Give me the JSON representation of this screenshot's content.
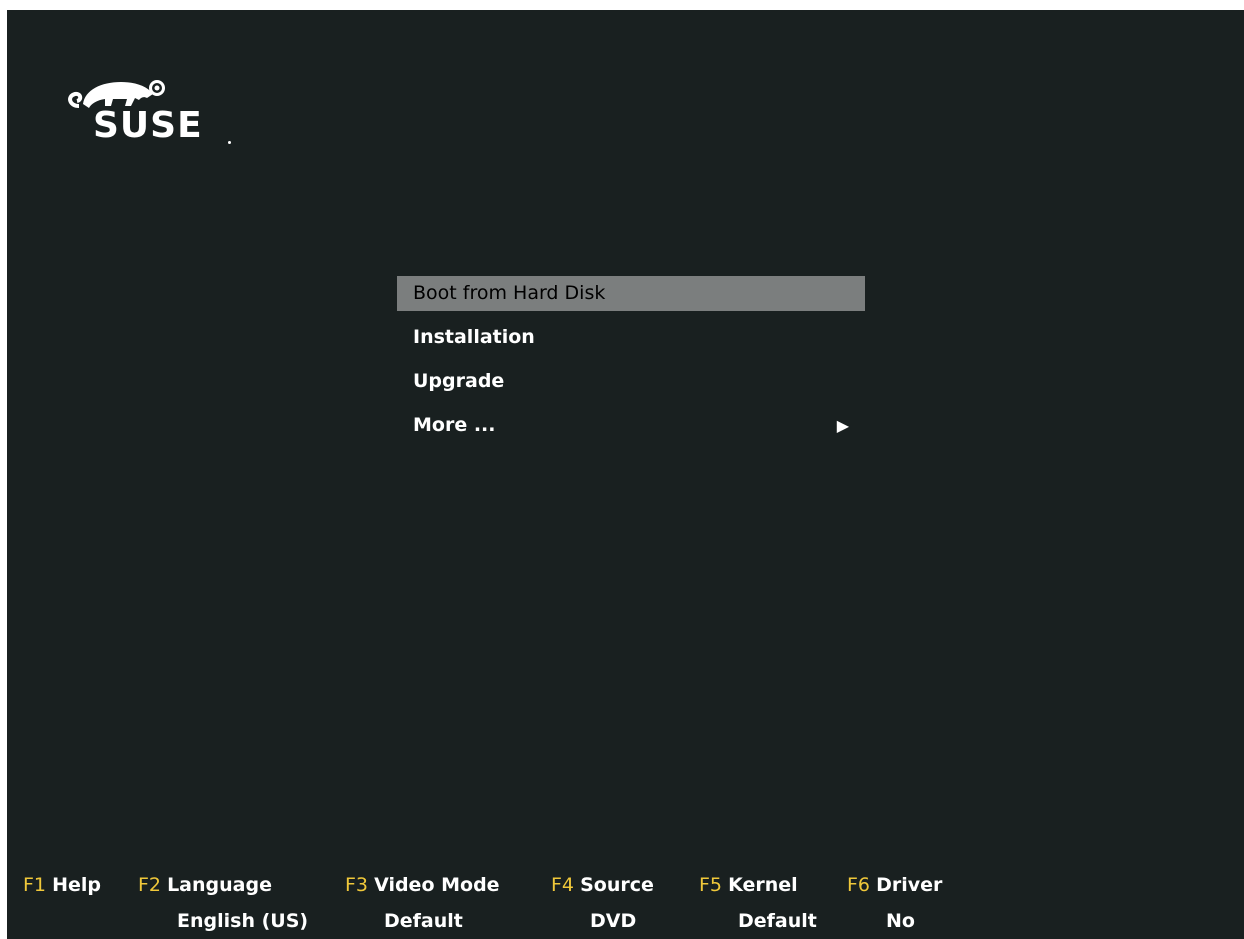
{
  "logo": {
    "text": "SUSE",
    "icon": "chameleon-logo-icon"
  },
  "menu": {
    "items": [
      {
        "label": "Boot from Hard Disk",
        "selected": true
      },
      {
        "label": "Installation",
        "selected": false
      },
      {
        "label": "Upgrade",
        "selected": false
      },
      {
        "label": "More ...",
        "selected": false,
        "submenu_icon": "right-triangle-icon"
      }
    ],
    "submenu_arrow": "▶"
  },
  "function_keys": [
    {
      "key": "F1",
      "label": "Help",
      "value": ""
    },
    {
      "key": "F2",
      "label": "Language",
      "value": "English (US)"
    },
    {
      "key": "F3",
      "label": "Video Mode",
      "value": "Default"
    },
    {
      "key": "F4",
      "label": "Source",
      "value": "DVD"
    },
    {
      "key": "F5",
      "label": "Kernel",
      "value": "Default"
    },
    {
      "key": "F6",
      "label": "Driver",
      "value": "No"
    }
  ],
  "colors": {
    "background": "#192020",
    "selection": "#7b7e7e",
    "function_key": "#f0c83a",
    "text": "#ffffff"
  }
}
